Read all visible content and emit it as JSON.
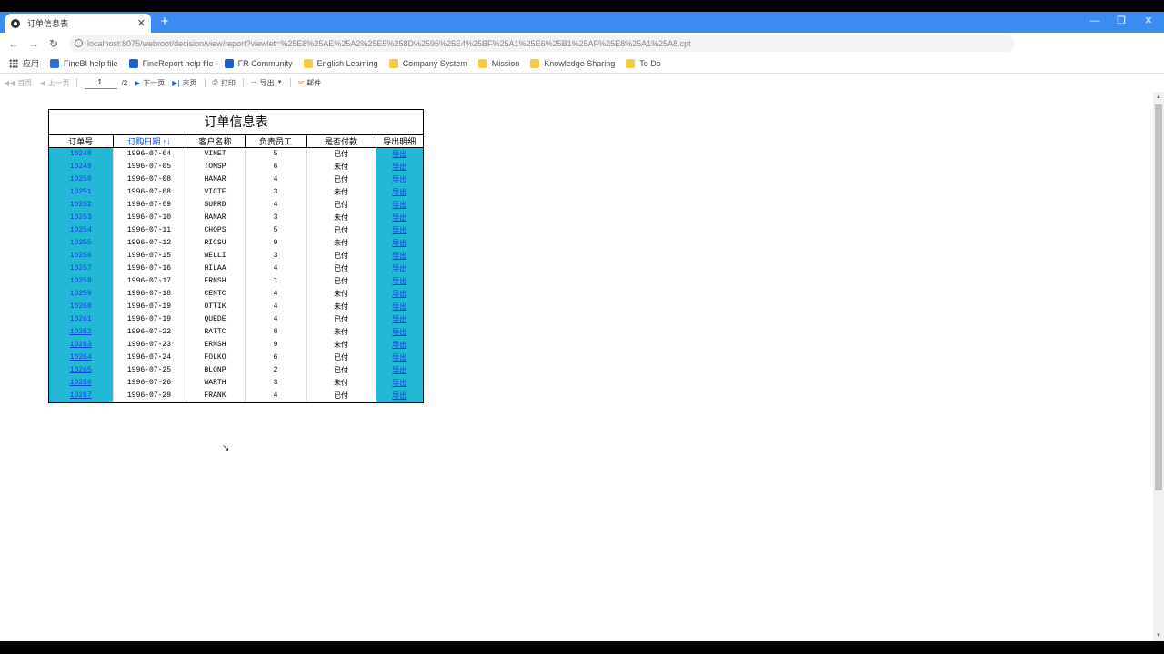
{
  "tab": {
    "title": "订单信息表",
    "close": "✕",
    "new_tab": "+"
  },
  "window_controls": {
    "minimize": "—",
    "restore": "❐",
    "close": "✕"
  },
  "address": {
    "url": "localhost:8075/webroot/decision/view/report?viewlet=%25E8%25AE%25A2%25E5%258D%2595%25E4%25BF%25A1%25E6%25B1%25AF%25E8%25A1%25A8.cpt"
  },
  "bookmarks": [
    {
      "label": "应用",
      "icon": "apps-icon"
    },
    {
      "label": "FineBI help file",
      "icon": "finebi-icon"
    },
    {
      "label": "FineReport help file",
      "icon": "finereport-icon"
    },
    {
      "label": "FR Community",
      "icon": "fr-community-icon"
    },
    {
      "label": "English Learning",
      "icon": "folder-icon"
    },
    {
      "label": "Company System",
      "icon": "folder-icon"
    },
    {
      "label": "Mission",
      "icon": "folder-icon"
    },
    {
      "label": "Knowledge Sharing",
      "icon": "folder-icon"
    },
    {
      "label": "To Do",
      "icon": "folder-icon"
    }
  ],
  "report_toolbar": {
    "first": "首页",
    "prev": "上一页",
    "page_value": "1",
    "total": "/2 ",
    "next": "下一页",
    "last": "末页",
    "print": "打印",
    "export": "导出",
    "mail": "邮件"
  },
  "report": {
    "title": "订单信息表",
    "headers": [
      "订单号",
      "订购日期 ↑↓",
      "客户名称",
      "负责员工",
      "是否付款",
      "导出明细"
    ],
    "rows": [
      [
        "10248",
        "1996-07-04",
        "VINET",
        "5",
        "已付",
        "导出"
      ],
      [
        "10249",
        "1996-07-05",
        "TOMSP",
        "6",
        "未付",
        "导出"
      ],
      [
        "10250",
        "1996-07-08",
        "HANAR",
        "4",
        "已付",
        "导出"
      ],
      [
        "10251",
        "1996-07-08",
        "VICTE",
        "3",
        "未付",
        "导出"
      ],
      [
        "10252",
        "1996-07-09",
        "SUPRD",
        "4",
        "已付",
        "导出"
      ],
      [
        "10253",
        "1996-07-10",
        "HANAR",
        "3",
        "未付",
        "导出"
      ],
      [
        "10254",
        "1996-07-11",
        "CHOPS",
        "5",
        "已付",
        "导出"
      ],
      [
        "10255",
        "1996-07-12",
        "RICSU",
        "9",
        "未付",
        "导出"
      ],
      [
        "10256",
        "1996-07-15",
        "WELLI",
        "3",
        "已付",
        "导出"
      ],
      [
        "10257",
        "1996-07-16",
        "HILAA",
        "4",
        "已付",
        "导出"
      ],
      [
        "10258",
        "1996-07-17",
        "ERNSH",
        "1",
        "已付",
        "导出"
      ],
      [
        "10259",
        "1996-07-18",
        "CENTC",
        "4",
        "未付",
        "导出"
      ],
      [
        "10260",
        "1996-07-19",
        "OTTIK",
        "4",
        "未付",
        "导出"
      ],
      [
        "10261",
        "1996-07-19",
        "QUEDE",
        "4",
        "已付",
        "导出"
      ],
      [
        "10262",
        "1996-07-22",
        "RATTC",
        "8",
        "未付",
        "导出"
      ],
      [
        "10263",
        "1996-07-23",
        "ERNSH",
        "9",
        "未付",
        "导出"
      ],
      [
        "10264",
        "1996-07-24",
        "FOLKO",
        "6",
        "已付",
        "导出"
      ],
      [
        "10265",
        "1996-07-25",
        "BLONP",
        "2",
        "已付",
        "导出"
      ],
      [
        "10266",
        "1996-07-26",
        "WARTH",
        "3",
        "未付",
        "导出"
      ],
      [
        "10267",
        "1996-07-29",
        "FRANK",
        "4",
        "已付",
        "导出"
      ]
    ],
    "underlined_from_index": 14
  },
  "colors": {
    "tab_strip": "#3c8bf1",
    "highlight_cell": "#23b8d6",
    "link": "#1144dd"
  }
}
